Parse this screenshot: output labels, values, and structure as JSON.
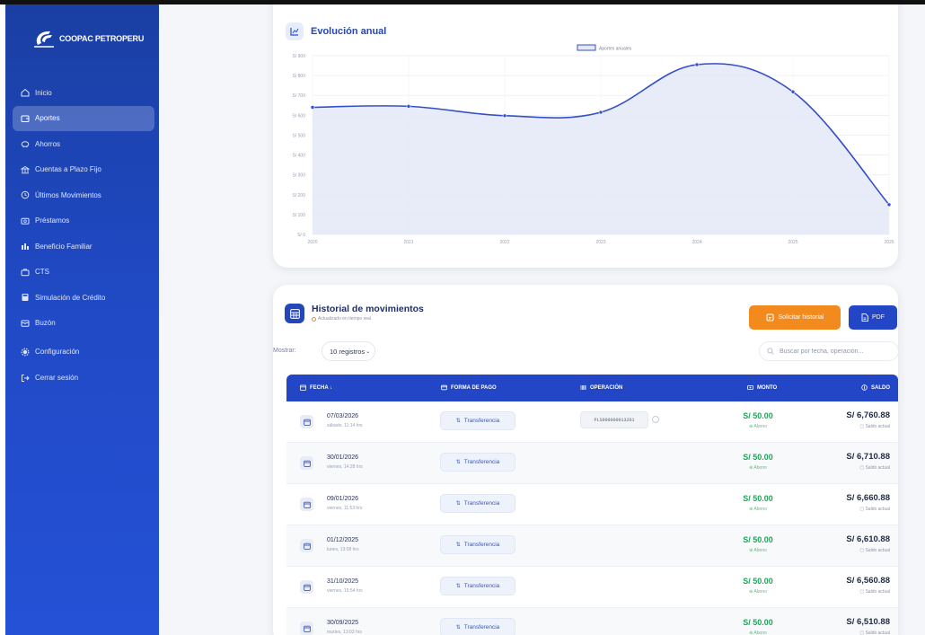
{
  "app": {
    "logo_text": "COOPAC PETROPERU"
  },
  "sidebar": {
    "items": [
      {
        "label": "Inicio",
        "icon": "home-icon",
        "active": false
      },
      {
        "label": "Aportes",
        "icon": "wallet-icon",
        "active": true
      },
      {
        "label": "Ahorros",
        "icon": "piggy-bank-icon",
        "active": false
      },
      {
        "label": "Cuentas a Plazo Fijo",
        "icon": "bank-icon",
        "active": false
      },
      {
        "label": "Últimos Movimientos",
        "icon": "clock-icon",
        "active": false
      },
      {
        "label": "Préstamos",
        "icon": "loan-icon",
        "active": false
      },
      {
        "label": "Beneficio Familiar",
        "icon": "family-icon",
        "active": false
      },
      {
        "label": "CTS",
        "icon": "briefcase-icon",
        "active": false
      },
      {
        "label": "Simulación de Crédito",
        "icon": "calculator-icon",
        "active": false
      },
      {
        "label": "Buzón",
        "icon": "mailbox-icon",
        "active": false
      },
      {
        "label": "Configuración",
        "icon": "gear-icon",
        "active": false
      },
      {
        "label": "Cerrar sesión",
        "icon": "logout-icon",
        "active": false
      }
    ]
  },
  "chart_card": {
    "title": "Evolución anual"
  },
  "chart_data": {
    "type": "area",
    "title": "Evolución anual",
    "x": [
      "2020",
      "2021",
      "2022",
      "2023",
      "2024",
      "2025",
      "2026"
    ],
    "series": [
      {
        "name": "Aportes anuales",
        "values": [
          640,
          645,
          598,
          615,
          855,
          718,
          150
        ]
      }
    ],
    "y_ticks": [
      "S/ 0",
      "S/ 100",
      "S/ 200",
      "S/ 300",
      "S/ 400",
      "S/ 500",
      "S/ 600",
      "S/ 700",
      "S/ 800",
      "S/ 900"
    ],
    "ylim": [
      0,
      900
    ],
    "legend_position": "top-center",
    "grid": true,
    "line_color": "#3350c8",
    "fill_color": "#e4e8f7"
  },
  "history": {
    "title": "Historial de movimientos",
    "subtitle": "Actualizado en tiempo real",
    "request_button": "Solicitar historial",
    "pdf_button": "PDF",
    "show_label": "Mostrar:",
    "show_value": "10 registros",
    "search_placeholder": "Buscar por fecha, operación...",
    "columns": {
      "date": "FECHA ↓",
      "payment": "FORMA DE PAGO",
      "operation": "OPERACIÓN",
      "amount": "MONTO",
      "balance": "SALDO"
    },
    "rows": [
      {
        "date": "07/03/2026",
        "time": "sábado, 11:14 hrs",
        "payment": "Transferencia",
        "operation": "PLS000000013201",
        "amount": "S/ 50.00",
        "amount_type": "Abono",
        "balance": "S/ 6,760.88",
        "balance_note": "Saldo actual"
      },
      {
        "date": "30/01/2026",
        "time": "viernes, 14:28 hrs",
        "payment": "Transferencia",
        "operation": "",
        "amount": "S/ 50.00",
        "amount_type": "Abono",
        "balance": "S/ 6,710.88",
        "balance_note": "Saldo actual"
      },
      {
        "date": "09/01/2026",
        "time": "viernes, 11:53 hrs",
        "payment": "Transferencia",
        "operation": "",
        "amount": "S/ 50.00",
        "amount_type": "Abono",
        "balance": "S/ 6,660.88",
        "balance_note": "Saldo actual"
      },
      {
        "date": "01/12/2025",
        "time": "lunes, 13:08 hrs",
        "payment": "Transferencia",
        "operation": "",
        "amount": "S/ 50.00",
        "amount_type": "Abono",
        "balance": "S/ 6,610.88",
        "balance_note": "Saldo actual"
      },
      {
        "date": "31/10/2025",
        "time": "viernes, 15:54 hrs",
        "payment": "Transferencia",
        "operation": "",
        "amount": "S/ 50.00",
        "amount_type": "Abono",
        "balance": "S/ 6,560.88",
        "balance_note": "Saldo actual"
      },
      {
        "date": "30/09/2025",
        "time": "martes, 13:03 hrs",
        "payment": "Transferencia",
        "operation": "",
        "amount": "S/ 50.00",
        "amount_type": "Abono",
        "balance": "S/ 6,510.88",
        "balance_note": "Saldo actual"
      }
    ]
  }
}
